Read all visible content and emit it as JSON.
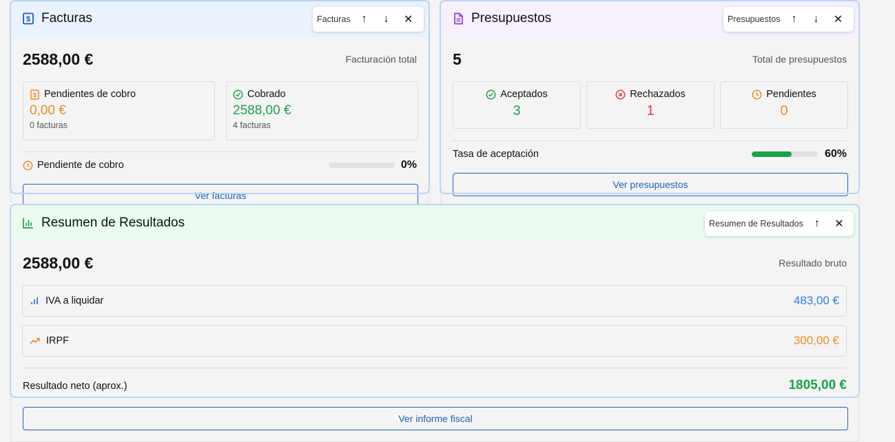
{
  "facturas": {
    "title": "Facturas",
    "toolbar_label": "Facturas",
    "total": "2588,00 €",
    "total_label": "Facturación total",
    "pendientes": {
      "label": "Pendientes de cobro",
      "amount": "0,00 €",
      "count": "0 facturas"
    },
    "cobrado": {
      "label": "Cobrado",
      "amount": "2588,00 €",
      "count": "4 facturas"
    },
    "pendiente_cobro": {
      "label": "Pendiente de cobro",
      "percent": "0%",
      "fraction": 0
    },
    "button": "Ver facturas"
  },
  "presupuestos": {
    "title": "Presupuestos",
    "toolbar_label": "Presupuestos",
    "total": "5",
    "total_label": "Total de presupuestos",
    "aceptados": {
      "label": "Aceptados",
      "value": "3"
    },
    "rechazados": {
      "label": "Rechazados",
      "value": "1"
    },
    "pendientes": {
      "label": "Pendientes",
      "value": "0"
    },
    "tasa": {
      "label": "Tasa de aceptación",
      "percent": "60%",
      "fraction": 0.6
    },
    "button": "Ver presupuestos"
  },
  "resultados": {
    "title": "Resumen de Resultados",
    "toolbar_label": "Resumen de Resultados",
    "total": "2588,00 €",
    "total_label": "Resultado bruto",
    "iva": {
      "label": "IVA a liquidar",
      "value": "483,00 €"
    },
    "irpf": {
      "label": "IRPF",
      "value": "300,00 €"
    },
    "neto": {
      "label": "Resultado neto (aprox.)",
      "value": "1805,00 €"
    },
    "button": "Ver informe fiscal"
  },
  "colors": {
    "blue": "#1d5fb8",
    "orange": "#f08a24",
    "green": "#1aa34a",
    "red": "#e23b3b",
    "purple": "#8b3fd1"
  },
  "icons": {
    "facturas": "dollar-doc-icon",
    "presupuestos": "document-icon",
    "resultados": "bar-chart-icon"
  }
}
